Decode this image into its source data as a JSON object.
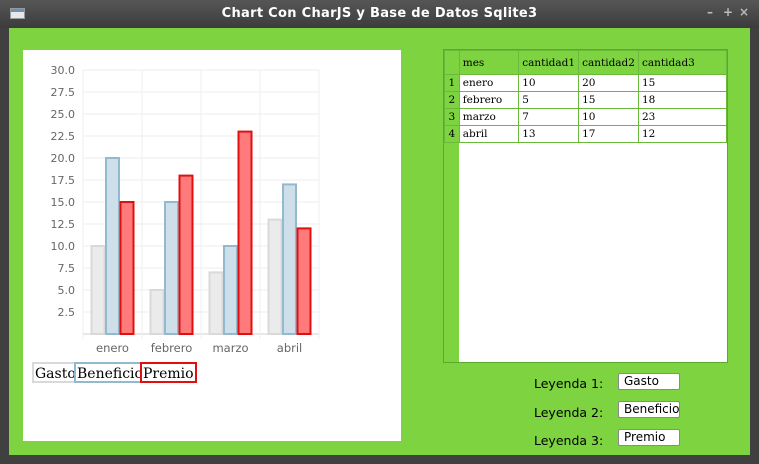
{
  "window": {
    "title": "Chart Con CharJS y Base de Datos Sqlite3",
    "controls": {
      "minimize": "–",
      "maximize": "+",
      "close": "×"
    }
  },
  "colors": {
    "panel_bg": "#7dd340",
    "gasto_fill": "#ebebeb",
    "gasto_border": "#d9d9d9",
    "beneficio_fill": "#cfdfe9",
    "beneficio_border": "#93b9cf",
    "premio_fill": "#ff7a7a",
    "premio_border": "#e01010"
  },
  "chart_data": {
    "type": "bar",
    "title": "",
    "xlabel": "",
    "ylabel": "",
    "categories": [
      "enero",
      "febrero",
      "marzo",
      "abril"
    ],
    "series": [
      {
        "name": "Gasto",
        "values": [
          10,
          5,
          7,
          13
        ]
      },
      {
        "name": "Beneficio",
        "values": [
          20,
          15,
          10,
          17
        ]
      },
      {
        "name": "Premio",
        "values": [
          15,
          18,
          23,
          12
        ]
      }
    ],
    "ylim": [
      0,
      30
    ],
    "yticks": [
      "2.5",
      "5.0",
      "7.5",
      "10.0",
      "12.5",
      "15.0",
      "17.5",
      "20.0",
      "22.5",
      "25.0",
      "27.5",
      "30.0"
    ],
    "grid": true,
    "legend": "bottom-left"
  },
  "legend": [
    "Gasto",
    "Beneficio",
    "Premio"
  ],
  "table": {
    "columns": [
      "mes",
      "cantidad1",
      "cantidad2",
      "cantidad3"
    ],
    "rows": [
      {
        "n": "1",
        "cells": [
          "enero",
          "10",
          "20",
          "15"
        ]
      },
      {
        "n": "2",
        "cells": [
          "febrero",
          "5",
          "15",
          "18"
        ]
      },
      {
        "n": "3",
        "cells": [
          "marzo",
          "7",
          "10",
          "23"
        ]
      },
      {
        "n": "4",
        "cells": [
          "abril",
          "13",
          "17",
          "12"
        ]
      }
    ]
  },
  "legend_form": [
    {
      "label": "Leyenda 1:",
      "value": "Gasto"
    },
    {
      "label": "Leyenda 2:",
      "value": "Beneficio"
    },
    {
      "label": "Leyenda 3:",
      "value": "Premio"
    }
  ]
}
